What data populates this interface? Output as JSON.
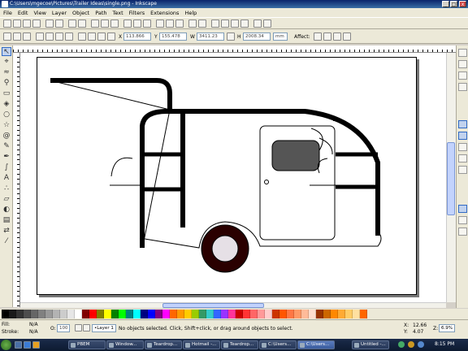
{
  "window": {
    "title": "C:\\Users\\mgecoe\\Pictures\\Trailer Ideas\\single.png - Inkscape",
    "minimize": "_",
    "maximize": "□",
    "close": "x"
  },
  "menu": [
    "File",
    "Edit",
    "View",
    "Layer",
    "Object",
    "Path",
    "Text",
    "Filters",
    "Extensions",
    "Help"
  ],
  "controls": {
    "x_value": "113.866",
    "y_value": "155.478",
    "w_value": "3411.23",
    "h_value": "2008.34",
    "unit": "mm",
    "affect_label": "Affect:"
  },
  "palette": [
    "#000000",
    "#1a1a1a",
    "#333333",
    "#4d4d4d",
    "#666666",
    "#808080",
    "#999999",
    "#b3b3b3",
    "#cccccc",
    "#e6e6e6",
    "#ffffff",
    "#800000",
    "#ff0000",
    "#808000",
    "#ffff00",
    "#008000",
    "#00ff00",
    "#008080",
    "#00ffff",
    "#000080",
    "#0000ff",
    "#800080",
    "#ff00ff",
    "#ff6600",
    "#ff9900",
    "#ffcc00",
    "#99cc00",
    "#339966",
    "#33cccc",
    "#3366ff",
    "#9933ff",
    "#ff3399",
    "#cc0000",
    "#ff3333",
    "#ff6666",
    "#ff9999",
    "#ffcccc",
    "#cc3300",
    "#ff5500",
    "#ff7744",
    "#ff9966",
    "#ffbb99",
    "#ffddcc",
    "#993300",
    "#cc6600",
    "#ff8800",
    "#ffaa33",
    "#ffcc66",
    "#ffe0a0",
    "#ff6600"
  ],
  "status": {
    "fill_label": "Fill:",
    "fill_value": "N/A",
    "stroke_label": "Stroke:",
    "stroke_value": "N/A",
    "opacity_label": "O:",
    "opacity_value": "100",
    "layer_value": "•Layer 1",
    "message": "No objects selected. Click, Shift+click, or drag around objects to select.",
    "x_label": "X:",
    "x_coord": "12.66",
    "y_label": "Y:",
    "y_coord": "4.07",
    "zoom_label": "Z:",
    "zoom_value": "6.9%"
  },
  "taskbar": {
    "tasks": [
      "PBEM",
      "Window...",
      "Teardrop...",
      "Hotmail -...",
      "Teardrop...",
      "C:\\Users...",
      "C:\\Users...",
      "Untitled -..."
    ],
    "clock": "8:15 PM"
  },
  "colors": {
    "trailer_stroke": "#000000",
    "wheel_fill": "#2a0000",
    "hubcap_fill": "#e6e0e6",
    "window_fill": "#555555"
  }
}
